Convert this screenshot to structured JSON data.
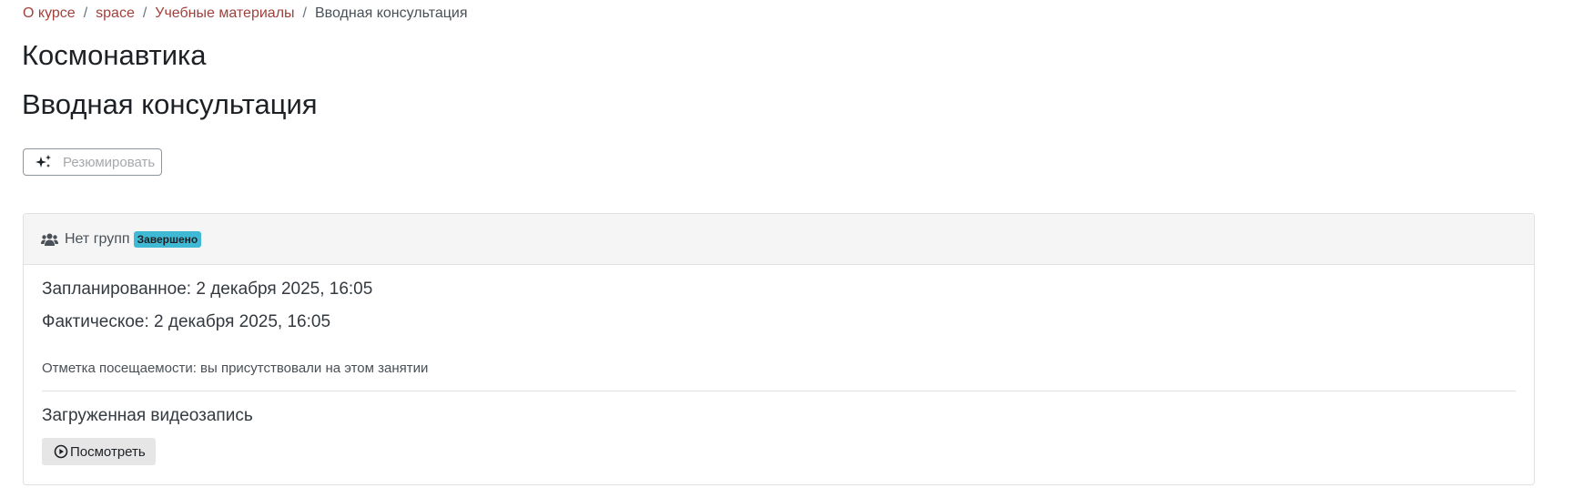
{
  "breadcrumb": {
    "items": [
      "О курсе",
      "space",
      "Учебные материалы"
    ],
    "current": "Вводная консультация",
    "separator": "/"
  },
  "course": {
    "title": "Космонавтика"
  },
  "page": {
    "title": "Вводная консультация"
  },
  "toolbar": {
    "summarize_label": "Резюмировать",
    "summarize_icon": "sparkles-icon"
  },
  "session": {
    "group_label": "Нет групп",
    "group_icon": "users-icon",
    "status_badge": "Завершено",
    "status_color": "#40b9d4",
    "scheduled": "Запланированное: 2 декабря 2025, 16:05",
    "actual": "Фактическое: 2 декабря 2025, 16:05",
    "attendance": "Отметка посещаемости: вы присутствовали на этом занятии",
    "video_title": "Загруженная видеозапись",
    "watch_label": "Посмотреть",
    "watch_icon": "play-circle-icon"
  },
  "colors": {
    "link": "#a0413c",
    "text": "#1d2125",
    "header_bg": "#f5f5f5"
  }
}
